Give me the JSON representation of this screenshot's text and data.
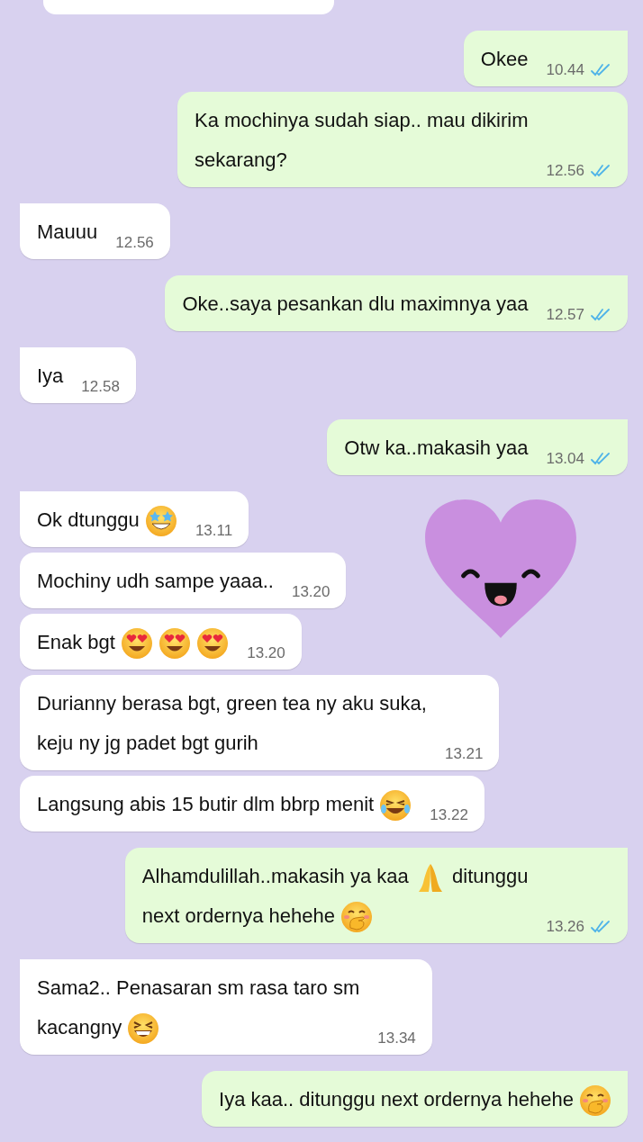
{
  "messages": [
    {
      "sent": true,
      "lines": [
        [
          {
            "kind": "text",
            "text": "Okee"
          }
        ]
      ],
      "time": "10.44",
      "read": true
    },
    {
      "sent": true,
      "lines": [
        [
          {
            "kind": "text",
            "text": "Ka mochinya sudah siap.. mau dikirim"
          }
        ],
        [
          {
            "kind": "text",
            "text": "sekarang?"
          }
        ]
      ],
      "time": "12.56",
      "read": true
    },
    {
      "sent": false,
      "lines": [
        [
          {
            "kind": "text",
            "text": "Mauuu"
          }
        ]
      ],
      "time": "12.56"
    },
    {
      "sent": true,
      "lines": [
        [
          {
            "kind": "text",
            "text": "Oke..saya pesankan dlu maximnya yaa"
          }
        ]
      ],
      "time": "12.57",
      "read": true
    },
    {
      "sent": false,
      "lines": [
        [
          {
            "kind": "text",
            "text": "Iya"
          }
        ]
      ],
      "time": "12.58"
    },
    {
      "sent": true,
      "lines": [
        [
          {
            "kind": "text",
            "text": "Otw ka..makasih yaa"
          }
        ]
      ],
      "time": "13.04",
      "read": true
    },
    {
      "sent": false,
      "lines": [
        [
          {
            "kind": "text",
            "text": "Ok dtunggu"
          },
          {
            "kind": "star_eyes"
          }
        ]
      ],
      "time": "13.11"
    },
    {
      "sent": false,
      "lines": [
        [
          {
            "kind": "text",
            "text": "Mochiny udh sampe yaaa.."
          }
        ]
      ],
      "time": "13.20"
    },
    {
      "sent": false,
      "lines": [
        [
          {
            "kind": "text",
            "text": "Enak bgt"
          },
          {
            "kind": "heart_eyes"
          },
          {
            "kind": "heart_eyes"
          },
          {
            "kind": "heart_eyes"
          }
        ]
      ],
      "time": "13.20"
    },
    {
      "sent": false,
      "lines": [
        [
          {
            "kind": "text",
            "text": "Durianny berasa bgt, green tea ny aku suka,"
          }
        ],
        [
          {
            "kind": "text",
            "text": "keju ny jg padet bgt gurih"
          }
        ]
      ],
      "time": "13.21"
    },
    {
      "sent": false,
      "lines": [
        [
          {
            "kind": "text",
            "text": "Langsung abis 15 butir dlm bbrp menit"
          },
          {
            "kind": "laughing"
          }
        ]
      ],
      "time": "13.22"
    },
    {
      "sent": true,
      "lines": [
        [
          {
            "kind": "text",
            "text": "Alhamdulillah..makasih ya kaa"
          },
          {
            "kind": "praying"
          },
          {
            "kind": "text",
            "text": "ditunggu"
          }
        ],
        [
          {
            "kind": "text",
            "text": "next ordernya hehehe"
          },
          {
            "kind": "hand_over_mouth"
          }
        ]
      ],
      "time": "13.26",
      "read": true
    },
    {
      "sent": false,
      "lines": [
        [
          {
            "kind": "text",
            "text": "Sama2.. Penasaran sm rasa taro sm"
          }
        ],
        [
          {
            "kind": "text",
            "text": "kacangny"
          },
          {
            "kind": "squinting"
          }
        ]
      ],
      "time": "13.34"
    },
    {
      "sent": true,
      "lines": [
        [
          {
            "kind": "text",
            "text": "Iya kaa.. ditunggu next ordernya hehehe"
          },
          {
            "kind": "hand_over_mouth"
          }
        ]
      ]
    }
  ]
}
